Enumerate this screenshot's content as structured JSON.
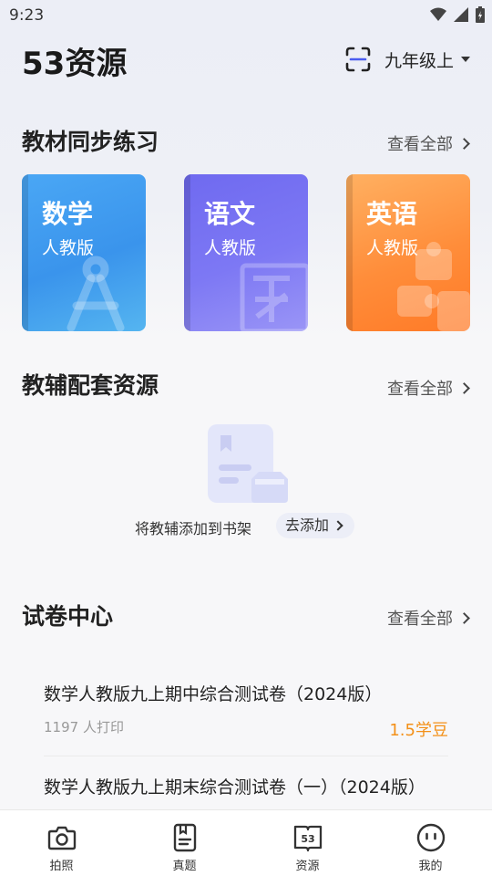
{
  "status_bar": {
    "time": "9:23"
  },
  "header": {
    "app_title": "53资源",
    "grade": "九年级上"
  },
  "textbook_section": {
    "title": "教材同步练习",
    "view_all": "查看全部",
    "books": [
      {
        "subject": "数学",
        "edition": "人教版"
      },
      {
        "subject": "语文",
        "edition": "人教版"
      },
      {
        "subject": "英语",
        "edition": "人教版"
      }
    ]
  },
  "supplementary_section": {
    "title": "教辅配套资源",
    "view_all": "查看全部",
    "empty_text": "将教辅添加到书架",
    "add_button": "去添加"
  },
  "exam_section": {
    "title": "试卷中心",
    "view_all": "查看全部",
    "papers": [
      {
        "title": "数学人教版九上期中综合测试卷（2024版）",
        "prints": "1197 人打印",
        "price": "1.5学豆"
      },
      {
        "title": "数学人教版九上期末综合测试卷（一）（2024版）"
      }
    ]
  },
  "bottom_nav": [
    {
      "label": "拍照",
      "icon": "camera-icon"
    },
    {
      "label": "真题",
      "icon": "document-icon"
    },
    {
      "label": "资源",
      "icon": "book-53-icon"
    },
    {
      "label": "我的",
      "icon": "face-icon"
    }
  ],
  "colors": {
    "math": "#3a94ec",
    "chinese": "#7d78f4",
    "english": "#ff8d3a",
    "price": "#f39018"
  }
}
